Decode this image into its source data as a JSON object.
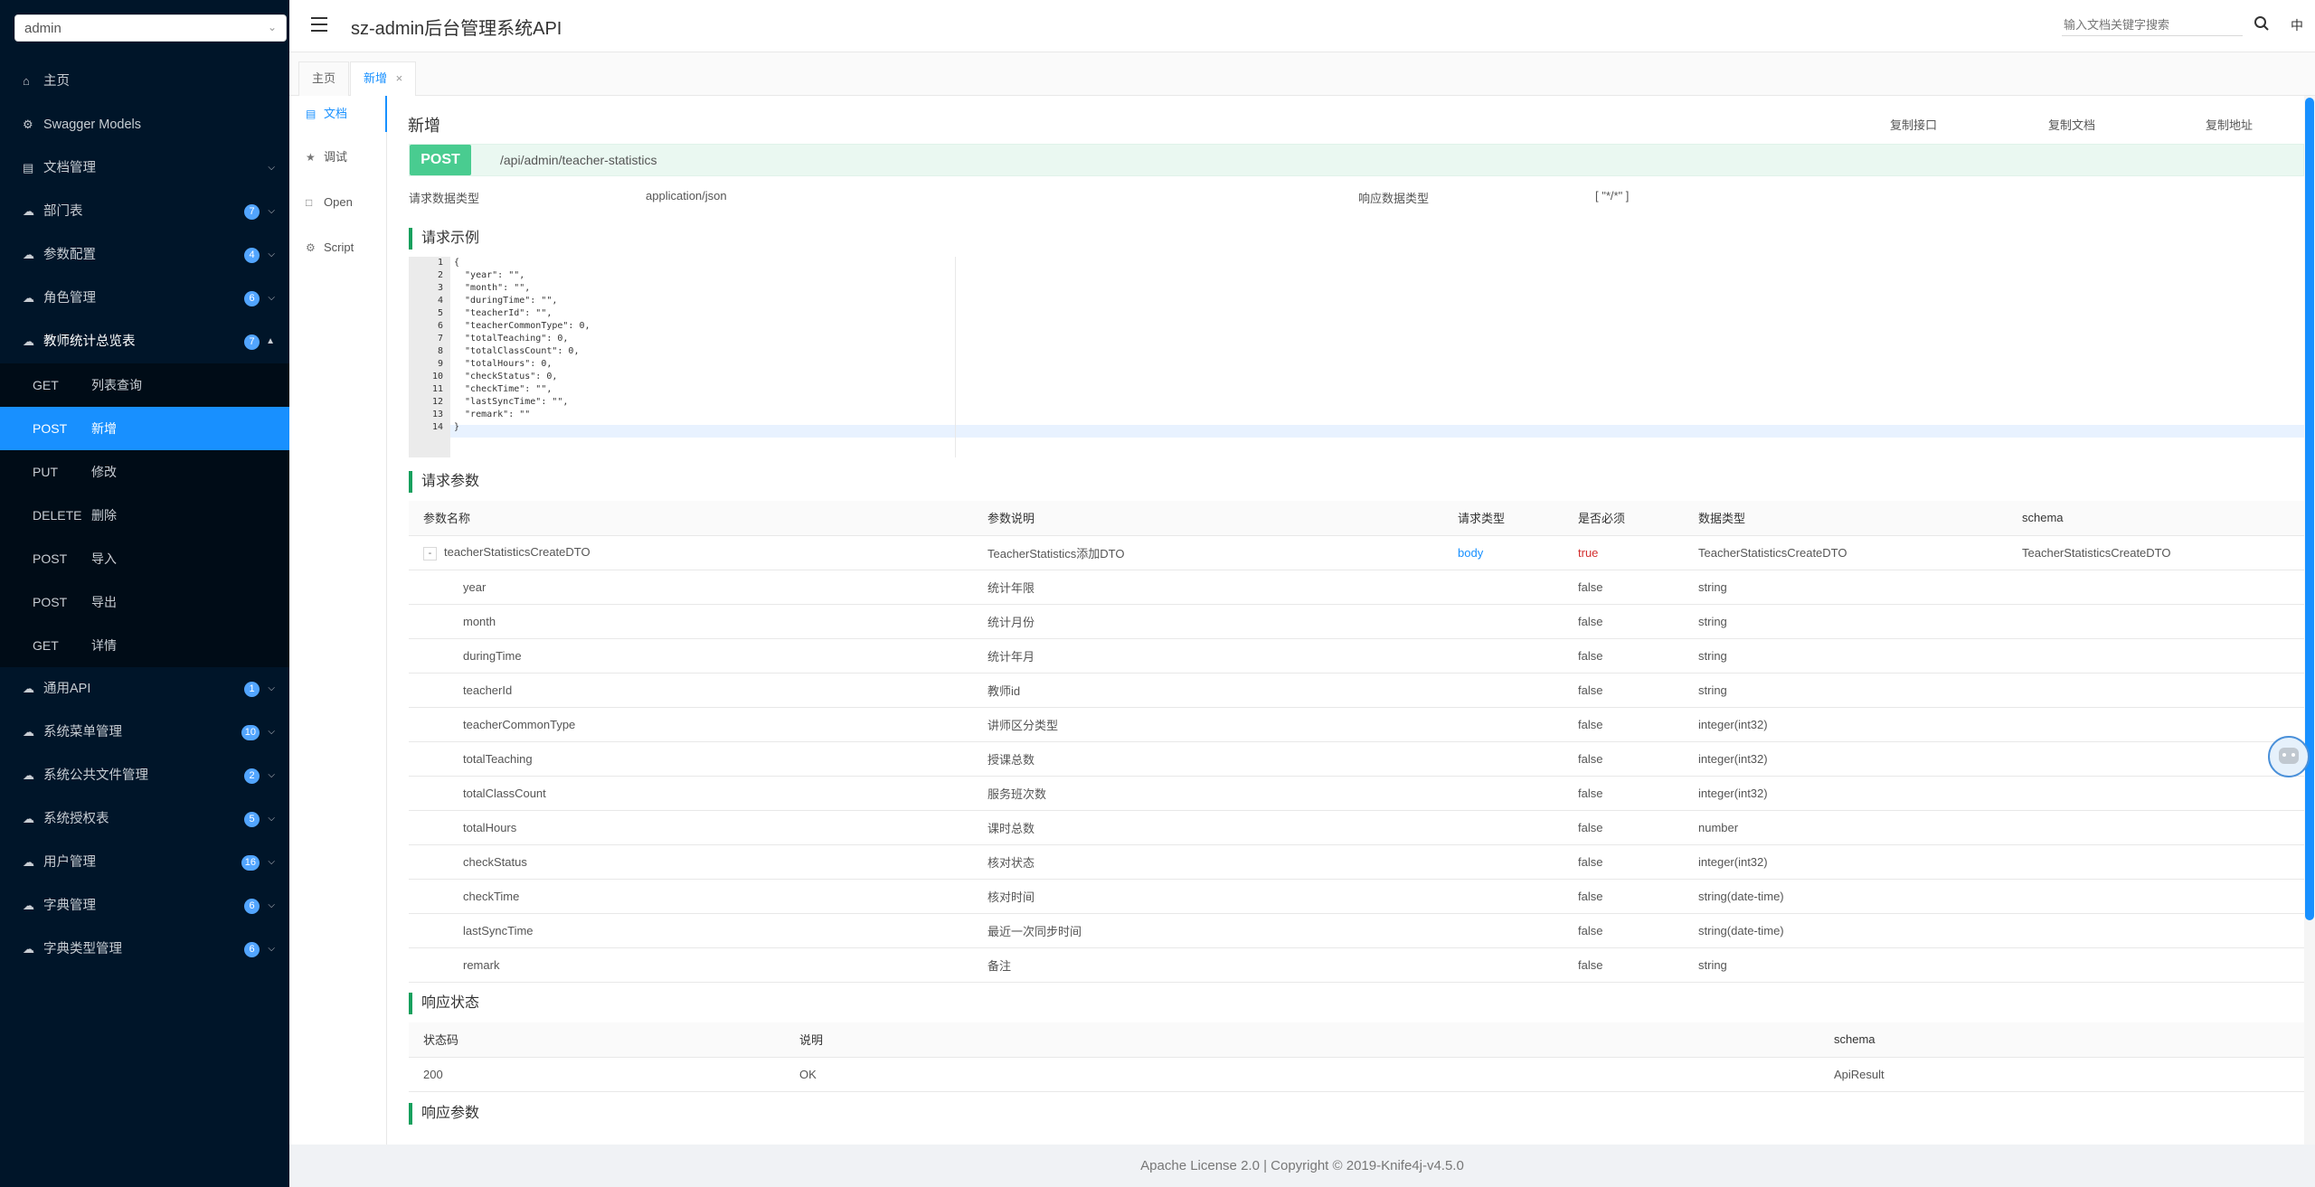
{
  "sidebar": {
    "group_select": "admin",
    "items": [
      {
        "label": "主页",
        "icon": "home-icon"
      },
      {
        "label": "Swagger Models",
        "icon": "models-icon"
      },
      {
        "label": "文档管理",
        "icon": "doc-manage-icon"
      },
      {
        "label": "部门表",
        "badge": "7",
        "icon": "cloud-icon"
      },
      {
        "label": "参数配置",
        "badge": "4",
        "icon": "cloud-icon"
      },
      {
        "label": "角色管理",
        "badge": "6",
        "icon": "cloud-icon"
      },
      {
        "label": "教师统计总览表",
        "badge": "7",
        "icon": "cloud-icon"
      },
      {
        "label": "通用API",
        "badge": "1",
        "icon": "cloud-icon"
      },
      {
        "label": "系统菜单管理",
        "badge": "10",
        "icon": "cloud-icon"
      },
      {
        "label": "系统公共文件管理",
        "badge": "2",
        "icon": "cloud-icon"
      },
      {
        "label": "系统授权表",
        "badge": "5",
        "icon": "cloud-icon"
      },
      {
        "label": "用户管理",
        "badge": "16",
        "icon": "cloud-icon"
      },
      {
        "label": "字典管理",
        "badge": "6",
        "icon": "cloud-icon"
      },
      {
        "label": "字典类型管理",
        "badge": "6",
        "icon": "cloud-icon"
      }
    ],
    "submenu": [
      {
        "method": "GET",
        "label": "列表查询"
      },
      {
        "method": "POST",
        "label": "新增"
      },
      {
        "method": "PUT",
        "label": "修改"
      },
      {
        "method": "DELETE",
        "label": "删除"
      },
      {
        "method": "POST",
        "label": "导入"
      },
      {
        "method": "POST",
        "label": "导出"
      },
      {
        "method": "GET",
        "label": "详情"
      }
    ]
  },
  "header": {
    "title": "sz-admin后台管理系统API",
    "search_placeholder": "输入文档关键字搜索",
    "lang": "中"
  },
  "tabs": {
    "home": "主页",
    "create": "新增",
    "close": "×"
  },
  "docnav": {
    "doc": "文档",
    "debug": "调试",
    "open": "Open",
    "script": "Script"
  },
  "operation": {
    "title": "新增",
    "copy_api": "复制接口",
    "copy_doc": "复制文档",
    "copy_url": "复制地址",
    "method": "POST",
    "path": "/api/admin/teacher-statistics",
    "request_type_label": "请求数据类型",
    "request_type": "application/json",
    "response_type_label": "响应数据类型",
    "response_type": "[ \"*/*\" ]"
  },
  "sections": {
    "request_example": "请求示例",
    "request_params": "请求参数",
    "response_status": "响应状态",
    "response_params": "响应参数"
  },
  "code": {
    "line_numbers": [
      "1",
      "2",
      "3",
      "4",
      "5",
      "6",
      "7",
      "8",
      "9",
      "10",
      "11",
      "12",
      "13",
      "14"
    ],
    "lines": [
      "{",
      "  \"year\": \"\",",
      "  \"month\": \"\",",
      "  \"duringTime\": \"\",",
      "  \"teacherId\": \"\",",
      "  \"teacherCommonType\": 0,",
      "  \"totalTeaching\": 0,",
      "  \"totalClassCount\": 0,",
      "  \"totalHours\": 0,",
      "  \"checkStatus\": 0,",
      "  \"checkTime\": \"\",",
      "  \"lastSyncTime\": \"\",",
      "  \"remark\": \"\"",
      "}"
    ]
  },
  "params_table": {
    "headers": [
      "参数名称",
      "参数说明",
      "请求类型",
      "是否必须",
      "数据类型",
      "schema"
    ],
    "root": {
      "expand": "-",
      "name": "teacherStatisticsCreateDTO",
      "desc": "TeacherStatistics添加DTO",
      "in": "body",
      "required": "true",
      "type": "TeacherStatisticsCreateDTO",
      "schema": "TeacherStatisticsCreateDTO"
    },
    "rows": [
      {
        "name": "year",
        "desc": "统计年限",
        "required": "false",
        "type": "string"
      },
      {
        "name": "month",
        "desc": "统计月份",
        "required": "false",
        "type": "string"
      },
      {
        "name": "duringTime",
        "desc": "统计年月",
        "required": "false",
        "type": "string"
      },
      {
        "name": "teacherId",
        "desc": "教师id",
        "required": "false",
        "type": "string"
      },
      {
        "name": "teacherCommonType",
        "desc": "讲师区分类型",
        "required": "false",
        "type": "integer(int32)"
      },
      {
        "name": "totalTeaching",
        "desc": "授课总数",
        "required": "false",
        "type": "integer(int32)"
      },
      {
        "name": "totalClassCount",
        "desc": "服务班次数",
        "required": "false",
        "type": "integer(int32)"
      },
      {
        "name": "totalHours",
        "desc": "课时总数",
        "required": "false",
        "type": "number"
      },
      {
        "name": "checkStatus",
        "desc": "核对状态",
        "required": "false",
        "type": "integer(int32)"
      },
      {
        "name": "checkTime",
        "desc": "核对时间",
        "required": "false",
        "type": "string(date-time)"
      },
      {
        "name": "lastSyncTime",
        "desc": "最近一次同步时间",
        "required": "false",
        "type": "string(date-time)"
      },
      {
        "name": "remark",
        "desc": "备注",
        "required": "false",
        "type": "string"
      }
    ]
  },
  "status_table": {
    "headers": [
      "状态码",
      "说明",
      "schema"
    ],
    "rows": [
      {
        "code": "200",
        "desc": "OK",
        "schema": "ApiResult"
      }
    ]
  },
  "footer": {
    "text": "Apache License 2.0 | Copyright © 2019-Knife4j-v4.5.0"
  },
  "colors": {
    "sidebar_bg": "#001529",
    "accent": "#1890ff",
    "post_green": "#49cc90",
    "section_bar": "#17a05d"
  }
}
